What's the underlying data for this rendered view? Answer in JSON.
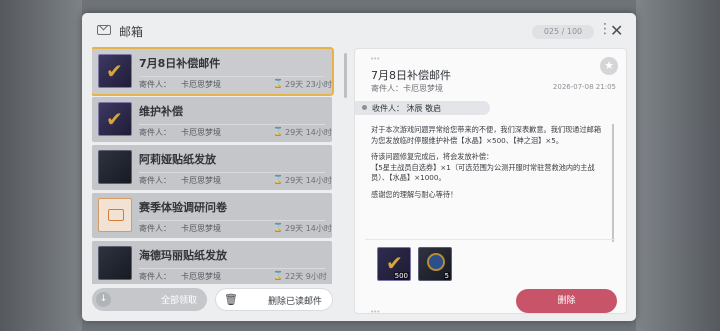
{
  "header": {
    "title": "邮箱",
    "counter": "025 / 100",
    "more_icon": "⋮",
    "close_icon": "✕"
  },
  "mail_list": [
    {
      "subject": "7月8日补偿邮件",
      "sender_label": "寄件人：",
      "sender": "卡厄思梦境",
      "expiry": "29天 23小时",
      "icon": "check-reward-icon"
    },
    {
      "subject": "维护补偿",
      "sender_label": "寄件人：",
      "sender": "卡厄思梦境",
      "expiry": "29天 14小时",
      "icon": "check-reward-icon"
    },
    {
      "subject": "阿莉娅贴纸发放",
      "sender_label": "寄件人：",
      "sender": "卡厄思梦境",
      "expiry": "29天 14小时",
      "icon": "character-portrait-icon"
    },
    {
      "subject": "赛季体验调研问卷",
      "sender_label": "寄件人：",
      "sender": "卡厄思梦境",
      "expiry": "29天 14小时",
      "icon": "envelope-icon"
    },
    {
      "subject": "海德玛丽贴纸发放",
      "sender_label": "寄件人：",
      "sender": "卡厄思梦境",
      "expiry": "22天 9小时",
      "icon": "character-portrait-icon"
    }
  ],
  "buttons": {
    "claim_all": "全部领取",
    "delete_read": "删除已读邮件",
    "delete": "删除"
  },
  "detail": {
    "title": "7月8日补偿邮件",
    "sender_label": "寄件人：",
    "sender": "卡厄思梦境",
    "date": "2026-07-08 21:05",
    "recipient": "收件人： 沐辰 敬启",
    "paragraphs": [
      "对于本次游戏问题异常给您带来的不便，我们深表歉意。我们现通过邮箱为您发放临时停服维护补偿【水晶】×500、【神之泪】×5。",
      "待该问题修复完成后，将会发放补偿：\n【5星主战员自选券】×1（可选范围为公测开服时常驻营救池内的主战员）、【水晶】×1000。",
      "感谢您的理解与耐心等待！"
    ],
    "attachments": [
      {
        "name": "check-reward-icon",
        "qty": "500"
      },
      {
        "name": "tear-orb-icon",
        "qty": "5"
      }
    ]
  },
  "colors": {
    "selected_border": "#e8b24a",
    "delete_button": "#c75468",
    "accent_gold": "#d5a73a"
  }
}
